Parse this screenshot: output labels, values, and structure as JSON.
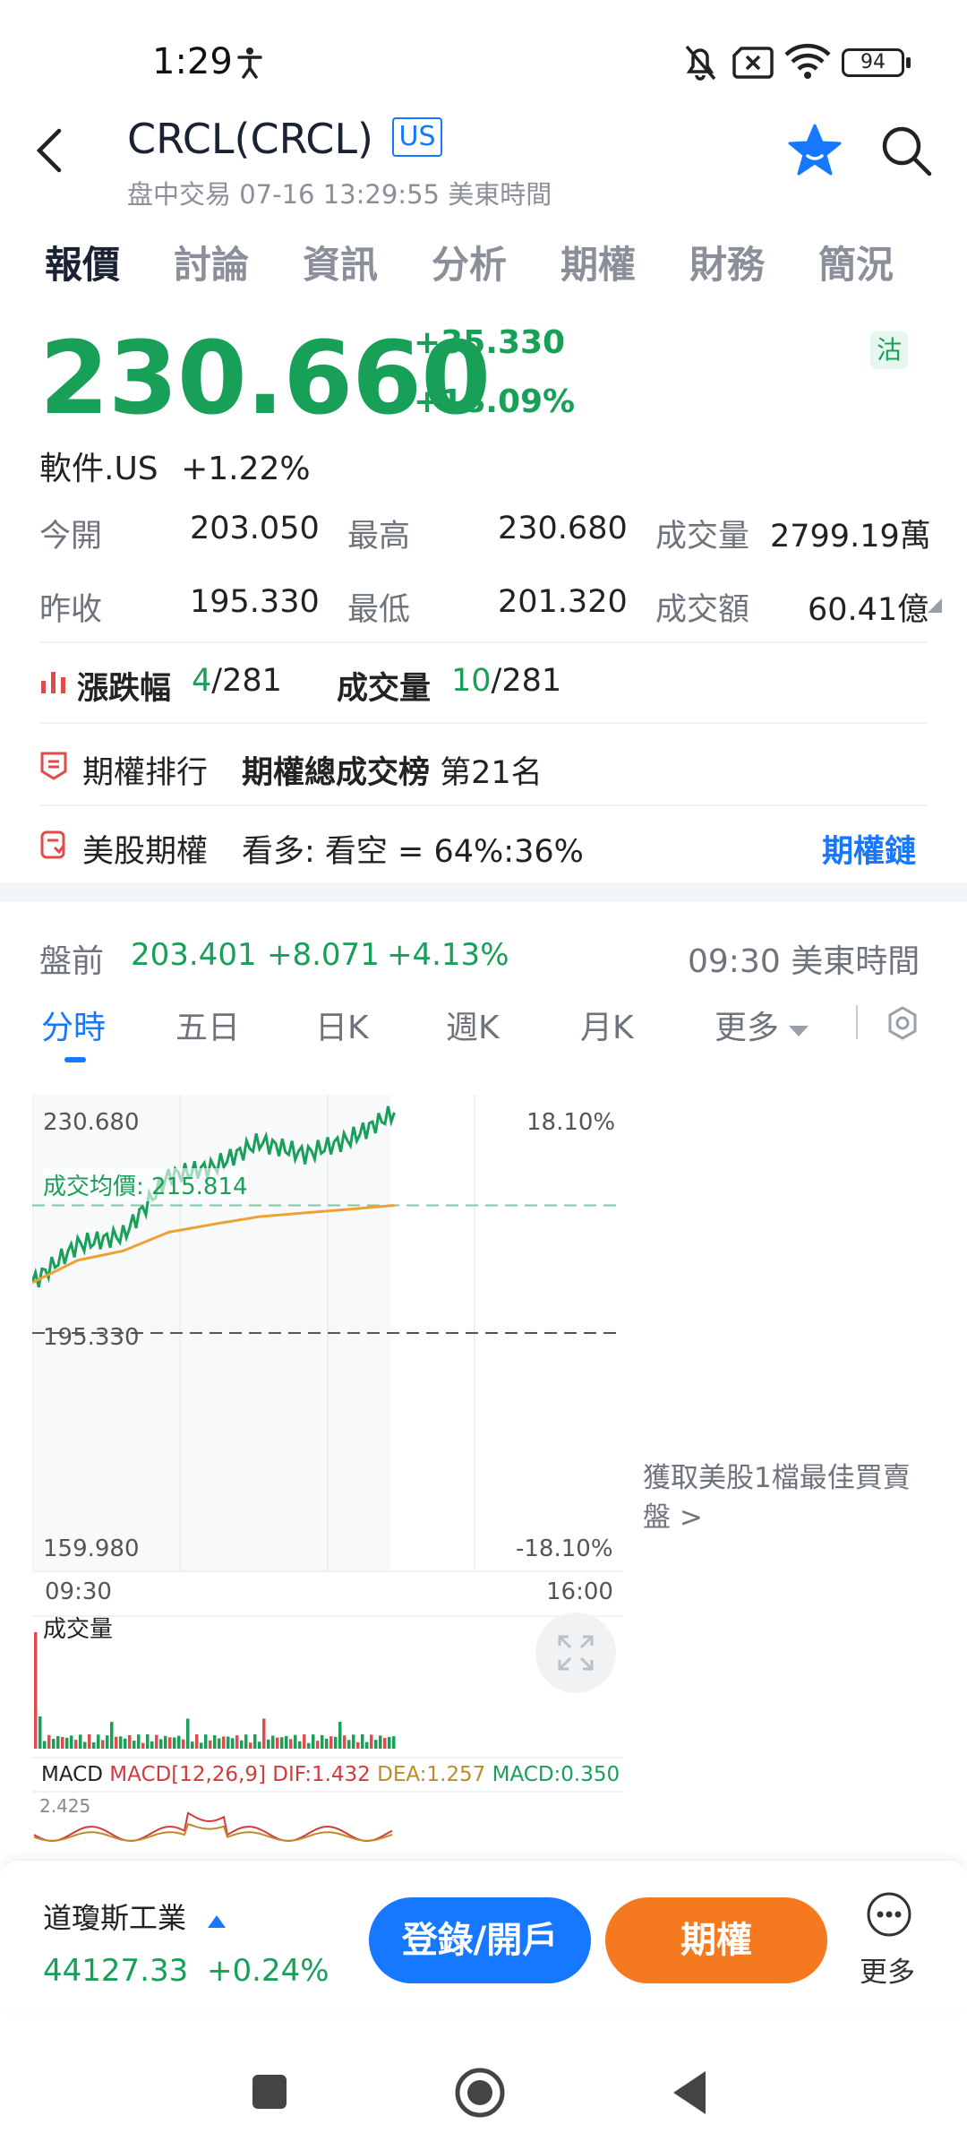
{
  "status": {
    "time": "1:29",
    "battery": "94"
  },
  "header": {
    "ticker": "CRCL(CRCL)",
    "market_badge": "US",
    "session": "盘中交易",
    "datetime": "07-16 13:29:55",
    "tz": "美東時間"
  },
  "tabs": [
    "報價",
    "討論",
    "資訊",
    "分析",
    "期權",
    "財務",
    "簡況"
  ],
  "quote": {
    "price": "230.660",
    "change": "+35.330",
    "change_pct": "+18.09%",
    "short_badge": "沽",
    "sector_name": "軟件.US",
    "sector_change": "+1.22%"
  },
  "stats": {
    "open_label": "今開",
    "open": "203.050",
    "high_label": "最高",
    "high": "230.680",
    "volume_label": "成交量",
    "volume": "2799.19萬",
    "prev_label": "昨收",
    "prev": "195.330",
    "low_label": "最低",
    "low": "201.320",
    "turnover_label": "成交額",
    "turnover": "60.41億"
  },
  "rank": {
    "change_label": "漲跌幅",
    "change_rank": "4",
    "change_total": "/281",
    "vol_label": "成交量",
    "vol_rank": "10",
    "vol_total": "/281"
  },
  "options_rank": {
    "label": "期權排行",
    "title": "期權總成交榜",
    "place": "第21名"
  },
  "us_options": {
    "label": "美股期權",
    "ratio": "看多: 看空 = 64%:36%",
    "link": "期權鏈"
  },
  "premarket": {
    "label": "盤前",
    "price": "203.401",
    "change": "+8.071",
    "pct": "+4.13%",
    "open_time": "09:30",
    "tz": "美東時間"
  },
  "kline_tabs": {
    "items": [
      "分時",
      "五日",
      "日K",
      "週K",
      "月K"
    ],
    "more": "更多"
  },
  "chart_data": {
    "type": "line",
    "series": [
      {
        "x": [
          "09:30",
          "10:00",
          "10:30",
          "11:00",
          "11:30",
          "12:00",
          "12:30",
          "13:00",
          "13:29"
        ],
        "values": [
          203.4,
          209.5,
          211.0,
          220.5,
          222.0,
          226.0,
          224.0,
          226.5,
          230.7
        ]
      },
      {
        "name": "成交均價",
        "x": [
          "09:30",
          "10:00",
          "10:30",
          "11:00",
          "11:30",
          "12:00",
          "12:30",
          "13:00",
          "13:29"
        ],
        "values": [
          203.4,
          207.0,
          208.5,
          211.5,
          212.8,
          214.0,
          214.6,
          215.2,
          215.8
        ]
      }
    ],
    "ylim": [
      159.98,
      230.68
    ],
    "prev_close": 195.33,
    "top_left": "230.680",
    "top_right": "18.10%",
    "mid_left": "195.330",
    "bottom_left": "159.980",
    "bottom_right": "-18.10%",
    "avg_label": "成交均價: 215.814",
    "x_start": "09:30",
    "x_end": "16:00",
    "volume_label": "成交量",
    "macd_header": "MACD",
    "macd_params": "MACD[12,26,9]",
    "macd_dif": "DIF:1.432",
    "macd_dea": "DEA:1.257",
    "macd_val": "MACD:0.350",
    "macd_top": "2.425",
    "price_color": "#18a058",
    "avg_color": "#f0a030"
  },
  "promo": "獲取美股1檔最佳買賣盤 >",
  "bottom": {
    "index_name": "道瓊斯工業",
    "index_value": "44127.33",
    "index_change": "+0.24%",
    "login_btn": "登錄/開戶",
    "options_btn": "期權",
    "more": "更多"
  }
}
